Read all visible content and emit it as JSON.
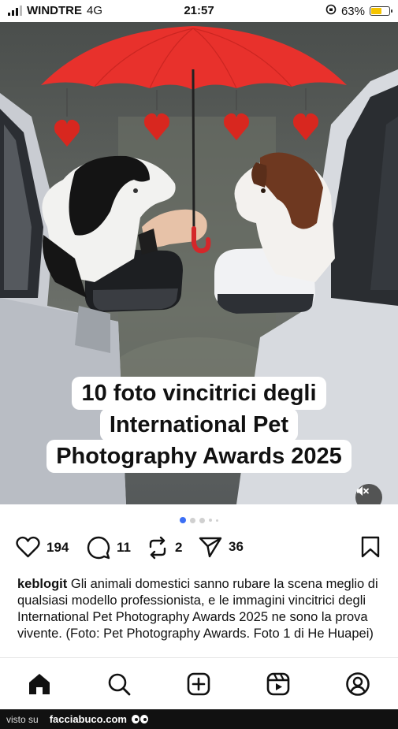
{
  "status_bar": {
    "carrier": "WINDTRE",
    "network": "4G",
    "time": "21:57",
    "battery": "63%",
    "battery_level": 0.63,
    "icons": [
      "signal-icon",
      "orientation-lock-icon",
      "battery-icon"
    ]
  },
  "post": {
    "image_caption_lines": [
      "10 foto vincitrici degli",
      "International Pet",
      "Photography Awards 2025"
    ],
    "carousel": {
      "total": 5,
      "current": 1
    },
    "likes": "194",
    "comments": "11",
    "reposts": "2",
    "shares": "36",
    "username": "keblogit",
    "caption": "Gli animali domestici sanno rubare la scena meglio di qualsiasi modello professionista, e le immagini vincitrici degli International Pet Photography Awards 2025 ne sono la prova vivente. (Foto: Pet Photography Awards. Foto 1 di He Huapei)"
  },
  "nav": {
    "items": [
      "home-icon",
      "search-icon",
      "create-icon",
      "reels-icon",
      "profile-icon"
    ]
  },
  "footer": {
    "prefix": "visto su",
    "brand": "facciabuco.com"
  },
  "colors": {
    "accent_blue": "#3c6ff5",
    "umbrella_red": "#e8312c",
    "battery_yellow": "#f5c400"
  }
}
